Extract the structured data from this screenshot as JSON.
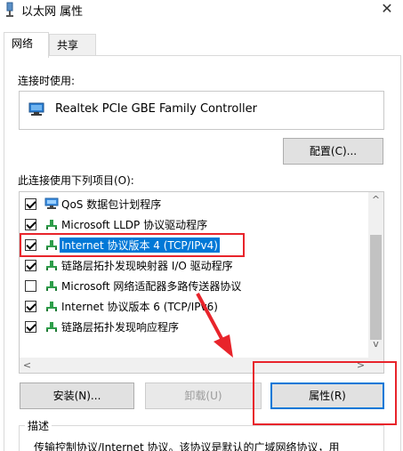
{
  "window": {
    "title": "以太网 属性",
    "close_glyph": "✕"
  },
  "tabs": [
    {
      "label": "网络",
      "active": true
    },
    {
      "label": "共享",
      "active": false
    }
  ],
  "connect_using": {
    "label": "连接时使用:",
    "adapter_name": "Realtek PCIe GBE Family Controller",
    "adapter_icon": "network-adapter-icon",
    "configure_label": "配置(C)..."
  },
  "items_section": {
    "label": "此连接使用下列项目(O):",
    "items": [
      {
        "label": "QoS 数据包计划程序",
        "checked": true,
        "icon": "qos-scheduler-icon",
        "selected": false
      },
      {
        "label": "Microsoft LLDP 协议驱动程序",
        "checked": true,
        "icon": "protocol-icon",
        "selected": false
      },
      {
        "label": "Internet 协议版本 4 (TCP/IPv4)",
        "checked": true,
        "icon": "protocol-icon",
        "selected": true
      },
      {
        "label": "链路层拓扑发现映射器 I/O 驱动程序",
        "checked": true,
        "icon": "protocol-icon",
        "selected": false
      },
      {
        "label": "Microsoft 网络适配器多路传送器协议",
        "checked": false,
        "icon": "protocol-icon",
        "selected": false
      },
      {
        "label": "Internet 协议版本 6 (TCP/IPv6)",
        "checked": true,
        "icon": "protocol-icon",
        "selected": false
      },
      {
        "label": "链路层拓扑发现响应程序",
        "checked": true,
        "icon": "protocol-icon",
        "selected": false
      }
    ],
    "scroll_up": "^",
    "scroll_down": "v",
    "scroll_left": "<",
    "scroll_right": ">"
  },
  "buttons": {
    "install": "安装(N)...",
    "uninstall": "卸载(U)",
    "properties": "属性(R)"
  },
  "description": {
    "legend": "描述",
    "text": "传输控制协议/Internet 协议。该协议是默认的广域网络协议，用"
  },
  "colors": {
    "selection": "#0078d7",
    "annotation": "#e8242b",
    "button_face": "#e1e1e1"
  }
}
